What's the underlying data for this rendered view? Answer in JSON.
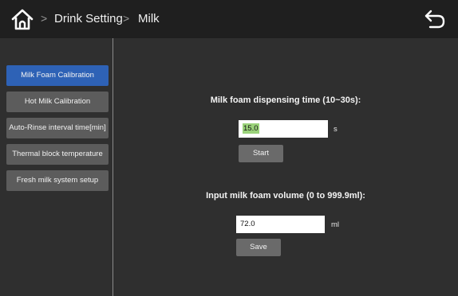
{
  "header": {
    "home_icon": "home-icon",
    "breadcrumb": [
      "Drink Setting",
      "Milk"
    ],
    "separator": ">",
    "back_icon": "back-arrow-icon"
  },
  "sidebar": {
    "items": [
      {
        "label": "Milk Foam Calibration",
        "active": true
      },
      {
        "label": "Hot Milk Calibration",
        "active": false
      },
      {
        "label": "Auto-Rinse interval time[min]",
        "active": false
      },
      {
        "label": "Thermal block temperature",
        "active": false
      },
      {
        "label": "Fresh milk system setup",
        "active": false
      }
    ]
  },
  "main": {
    "dispense": {
      "label": "Milk foam dispensing time (10~30s):",
      "value": "15.0",
      "unit": "s",
      "button": "Start"
    },
    "volume": {
      "label": "Input  milk foam volume (0 to 999.9ml):",
      "value": "72.0",
      "unit": "ml",
      "button": "Save"
    }
  },
  "colors": {
    "background": "#2f2f2f",
    "header": "#1f1f1f",
    "active_item": "#2e62b6",
    "item": "#5c5c5c",
    "button": "#6a6a6a",
    "selection": "#9ad27a"
  }
}
